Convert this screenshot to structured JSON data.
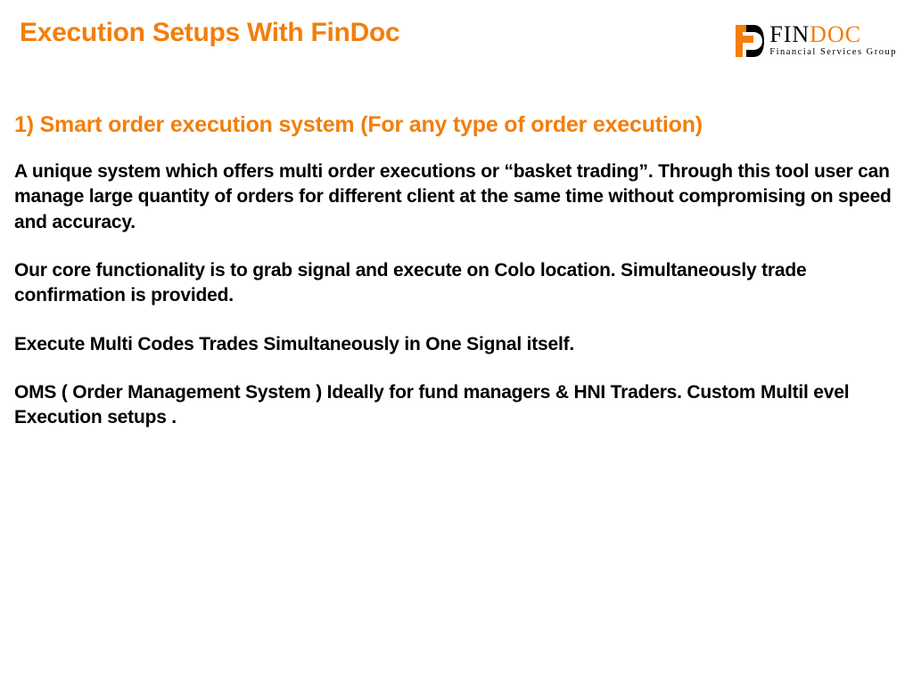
{
  "header": {
    "title": "Execution Setups With FinDoc"
  },
  "logo": {
    "brand_f": "F",
    "brand_in": "IN",
    "brand_doc": "DOC",
    "tagline": "Financial Services Group"
  },
  "section": {
    "heading": "1) Smart order execution system (For any type of order execution)",
    "paragraphs": [
      "A unique system which offers multi order executions or “basket trading”. Through this tool user can manage large quantity of orders for different client at the same time without compromising on speed and accuracy.",
      "Our core functionality is to grab signal and execute on Colo location. Simultaneously trade confirmation is provided.",
      "Execute Multi Codes  Trades Simultaneously in One Signal itself.",
      "OMS ( Order Management System ) Ideally for fund managers & HNI Traders. Custom Multil evel Execution setups ."
    ]
  }
}
